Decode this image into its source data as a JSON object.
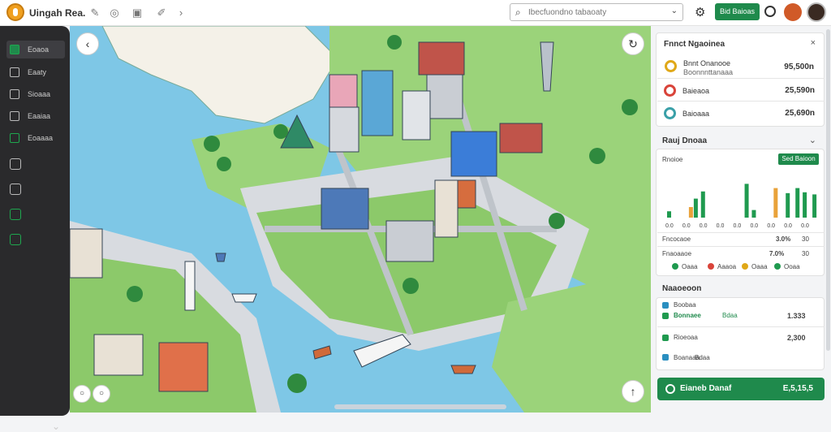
{
  "app": {
    "title": "Uingah Rea."
  },
  "topbar": {
    "search_placeholder": "Ibecfuondno tabaoaty",
    "action_button": "Bid Baioas"
  },
  "sidebar": {
    "items": [
      {
        "label": "Eoaoa"
      },
      {
        "label": "Eaaty"
      },
      {
        "label": "Sioaaa"
      },
      {
        "label": "Eaaiaa"
      },
      {
        "label": "Eoaaaa"
      }
    ]
  },
  "panel1": {
    "title": "Fnnct Ngaoinea",
    "rows": [
      {
        "label": "Bnnt Onanooe",
        "sublabel": "Boonnnttanaaa",
        "value": "95,500n",
        "color": "#e0a818"
      },
      {
        "label": "Baieaoa",
        "value": "25,590n",
        "color": "#d9443a"
      },
      {
        "label": "Baioaaa",
        "value": "25,690n",
        "color": "#3aa0a8"
      }
    ]
  },
  "panel2": {
    "title": "Rauj Dnoaa",
    "subtitle": "Rnoioe",
    "badge": "Sed Baioon",
    "chart_data": {
      "type": "bar",
      "x_ticks": [
        "0.0",
        "0.0",
        "0.0",
        "0.0",
        "0.0",
        "0.0",
        "0.0",
        "0.0",
        "0.0"
      ],
      "series": [
        {
          "color": "#1f9a4f",
          "values": [
            15,
            0,
            62,
            0,
            0,
            18,
            0,
            58,
            60
          ]
        },
        {
          "color": "#e9a23a",
          "values": [
            0,
            25,
            0,
            0,
            0,
            0,
            70,
            0,
            0
          ]
        },
        {
          "color": "#1f9a4f",
          "values": [
            0,
            45,
            0,
            0,
            80,
            0,
            0,
            70,
            55
          ]
        }
      ]
    },
    "stats": [
      {
        "label": "Fncocaoe",
        "value": "3.0%",
        "value2": "30"
      },
      {
        "label": "Fnaoaaoe",
        "value": "7.0%",
        "value2": "30"
      }
    ],
    "legend": [
      {
        "label": "Oaaa",
        "color": "#1f9a4f"
      },
      {
        "label": "Aaaoa",
        "color": "#d9443a"
      },
      {
        "label": "Oaaa",
        "color": "#e0a818"
      },
      {
        "label": "Ooaa",
        "color": "#1f9a4f"
      }
    ]
  },
  "panel3": {
    "title": "Naaoeoon",
    "rows": [
      {
        "lines": [
          "Boobaa",
          "Bonnaee"
        ],
        "tag": "Bdaa",
        "value": "1.333"
      },
      {
        "lines": [
          "Rioeoaa",
          "Boanaaa"
        ],
        "tag": "Bdaa",
        "value": "2,300"
      }
    ]
  },
  "footer_button": {
    "label": "Eianeb Danaf",
    "value": "E,5,15,5"
  }
}
